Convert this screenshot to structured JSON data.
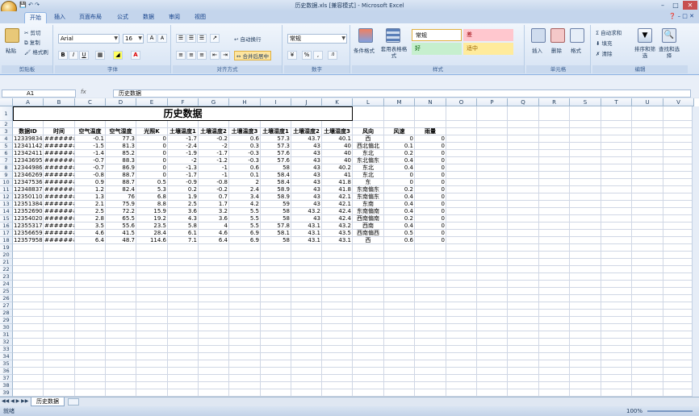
{
  "window": {
    "title": "历史数据.xls [兼容模式] - Microsoft Excel"
  },
  "tabs": [
    "开始",
    "插入",
    "页面布局",
    "公式",
    "数据",
    "审阅",
    "视图"
  ],
  "ribbon": {
    "clipboard": {
      "label": "剪贴板",
      "paste": "粘贴",
      "cut": "剪切",
      "copy": "复制",
      "format_painter": "格式刷"
    },
    "font": {
      "label": "字体",
      "name": "Arial",
      "size": "16",
      "bold": "B",
      "italic": "I",
      "underline": "U",
      "grow": "A",
      "shrink": "A"
    },
    "alignment": {
      "label": "对齐方式",
      "wrap": "自动换行",
      "merge": "合并后居中"
    },
    "number": {
      "label": "数字",
      "format": "常规",
      "percent": "%",
      "comma": ","
    },
    "styles": {
      "label": "样式",
      "conditional": "条件格式",
      "table": "套用表格格式",
      "normal": "常规",
      "bad": "差",
      "good": "好",
      "neutral": "适中"
    },
    "cells": {
      "label": "单元格",
      "insert": "插入",
      "delete": "删除",
      "format": "格式"
    },
    "editing": {
      "label": "编辑",
      "autosum": "Σ 自动求和",
      "fill": "填充",
      "clear": "清除",
      "sort": "排序和筛选",
      "find": "查找和选择"
    }
  },
  "formula_bar": {
    "name_box": "A1",
    "fx": "fx",
    "content": "历史数据"
  },
  "columns": [
    "A",
    "B",
    "C",
    "D",
    "E",
    "F",
    "G",
    "H",
    "I",
    "J",
    "K",
    "L",
    "M",
    "N",
    "O",
    "P",
    "Q",
    "R",
    "S",
    "T",
    "U",
    "V"
  ],
  "sheet": {
    "title": "历史数据",
    "headers": [
      "数据ID",
      "时间",
      "空气温度",
      "空气湿度",
      "光照K",
      "土壤温度1",
      "土壤温度2",
      "土壤温度3",
      "土壤湿度1",
      "土壤湿度2",
      "土壤湿度3",
      "风向",
      "风速",
      "雨量"
    ],
    "rows": [
      [
        "12339834",
        "########",
        "-0.1",
        "77.3",
        "0",
        "-1.7",
        "-0.2",
        "0.6",
        "57.3",
        "43.7",
        "40.1",
        "西",
        "0",
        "0"
      ],
      [
        "12341142",
        "########",
        "-1.5",
        "81.3",
        "0",
        "-2.4",
        "-2",
        "0.3",
        "57.3",
        "43",
        "40",
        "西北偏北",
        "0.1",
        "0"
      ],
      [
        "12342411",
        "########",
        "-1.4",
        "85.2",
        "0",
        "-1.9",
        "-1.7",
        "-0.3",
        "57.6",
        "43",
        "40",
        "东北",
        "0.2",
        "0"
      ],
      [
        "12343695",
        "########",
        "-0.7",
        "88.3",
        "0",
        "-2",
        "-1.2",
        "-0.3",
        "57.6",
        "43",
        "40",
        "东北偏东",
        "0.4",
        "0"
      ],
      [
        "12344986",
        "########",
        "-0.7",
        "86.9",
        "0",
        "-1.3",
        "-1",
        "0.6",
        "58",
        "43",
        "40.2",
        "东北",
        "0.4",
        "0"
      ],
      [
        "12346269",
        "########",
        "-0.8",
        "88.7",
        "0",
        "-1.7",
        "-1",
        "0.1",
        "58.4",
        "43",
        "41",
        "东北",
        "0",
        "0"
      ],
      [
        "12347536",
        "########",
        "0.9",
        "88.7",
        "0.5",
        "-0.9",
        "-0.8",
        "2",
        "58.4",
        "43",
        "41.8",
        "东",
        "0",
        "0"
      ],
      [
        "12348837",
        "########",
        "1.2",
        "82.4",
        "5.3",
        "0.2",
        "-0.2",
        "2.4",
        "58.9",
        "43",
        "41.8",
        "东南偏东",
        "0.2",
        "0"
      ],
      [
        "12350110",
        "########",
        "1.3",
        "76",
        "6.8",
        "1.9",
        "0.7",
        "3.4",
        "58.9",
        "43",
        "42.1",
        "东南偏东",
        "0.4",
        "0"
      ],
      [
        "12351384",
        "########",
        "2.1",
        "75.9",
        "8.8",
        "2.5",
        "1.7",
        "4.2",
        "59",
        "43",
        "42.1",
        "东南",
        "0.4",
        "0"
      ],
      [
        "12352690",
        "########",
        "2.5",
        "72.2",
        "15.9",
        "3.6",
        "3.2",
        "5.5",
        "58",
        "43.2",
        "42.4",
        "东南偏南",
        "0.4",
        "0"
      ],
      [
        "12354020",
        "########",
        "2.8",
        "65.5",
        "19.2",
        "4.3",
        "3.6",
        "5.5",
        "58",
        "43",
        "42.4",
        "西南偏南",
        "0.2",
        "0"
      ],
      [
        "12355317",
        "########",
        "3.5",
        "55.6",
        "23.5",
        "5.8",
        "4",
        "5.5",
        "57.8",
        "43.1",
        "43.2",
        "西南",
        "0.4",
        "0"
      ],
      [
        "12356659",
        "########",
        "4.6",
        "41.5",
        "28.4",
        "6.1",
        "4.6",
        "6.9",
        "58.1",
        "43.1",
        "43.5",
        "西南偏西",
        "0.5",
        "0"
      ],
      [
        "12357958",
        "########",
        "6.4",
        "48.7",
        "114.6",
        "7.1",
        "6.4",
        "6.9",
        "58",
        "43.1",
        "43.1",
        "西",
        "0.6",
        "0"
      ]
    ]
  },
  "sheet_tab": "历史数据",
  "status": {
    "left": "就绪",
    "zoom": "100%"
  }
}
